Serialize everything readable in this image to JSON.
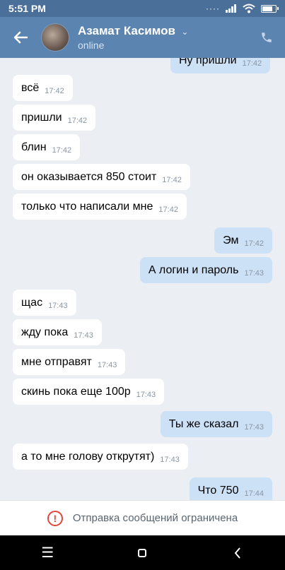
{
  "status_bar": {
    "time": "5:51 PM",
    "dots": "····"
  },
  "header": {
    "contact_name": "Азамат Касимов",
    "contact_status": "online"
  },
  "messages": [
    {
      "dir": "out",
      "text": "Ну пришли",
      "time": "17:42"
    },
    {
      "dir": "in",
      "text": "всё",
      "time": "17:42"
    },
    {
      "dir": "in",
      "text": "пришли",
      "time": "17:42"
    },
    {
      "dir": "in",
      "text": "блин",
      "time": "17:42"
    },
    {
      "dir": "in",
      "text": "он оказывается 850 стоит",
      "time": "17:42"
    },
    {
      "dir": "in",
      "text": "только что написали мне",
      "time": "17:42"
    },
    {
      "dir": "out",
      "text": "Эм",
      "time": "17:42"
    },
    {
      "dir": "out",
      "text": "А логин и пароль",
      "time": "17:43"
    },
    {
      "dir": "in",
      "text": "щас",
      "time": "17:43"
    },
    {
      "dir": "in",
      "text": "жду пока",
      "time": "17:43"
    },
    {
      "dir": "in",
      "text": "мне отправят",
      "time": "17:43"
    },
    {
      "dir": "in",
      "text": "скинь пока еще 100р",
      "time": "17:43"
    },
    {
      "dir": "out",
      "text": "Ты же сказал",
      "time": "17:43"
    },
    {
      "dir": "in",
      "text": "а то мне голову открутят)",
      "time": "17:43"
    },
    {
      "dir": "out",
      "text": "Что 750",
      "time": "17:44"
    }
  ],
  "bottom_bar": {
    "notice": "Отправка сообщений ограничена"
  },
  "icons": {
    "back": "back-arrow-icon",
    "call": "phone-icon",
    "warning": "warning-icon",
    "menu": "menu-icon",
    "home": "home-icon",
    "back_nav": "nav-back-icon"
  },
  "colors": {
    "header": "#5b84b1",
    "incoming": "#ffffff",
    "outgoing": "#cce0f6",
    "warning": "#e0473c"
  }
}
